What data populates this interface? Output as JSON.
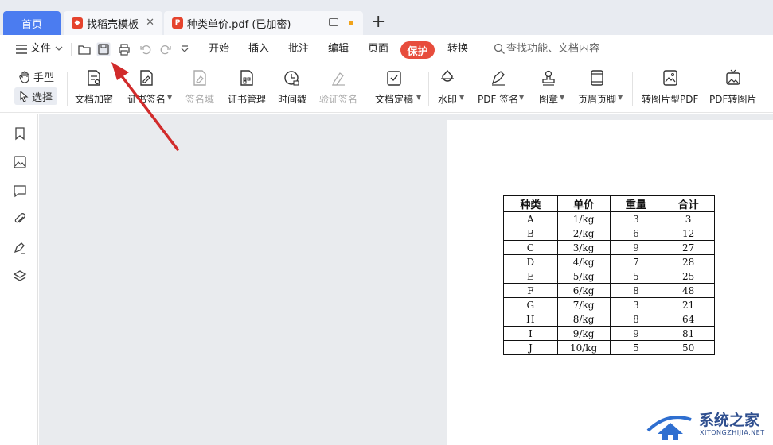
{
  "tabs": {
    "home": "首页",
    "tab1": "找稻壳模板",
    "tab2": "种类单价.pdf (已加密)"
  },
  "menu": {
    "file": "文件",
    "items": [
      "开始",
      "插入",
      "批注",
      "编辑",
      "页面",
      "保护",
      "转换"
    ],
    "search_placeholder": "查找功能、文档内容"
  },
  "ribbon": {
    "hand": "手型",
    "select": "选择",
    "buttons": [
      "文档加密",
      "证书签名",
      "签名域",
      "证书管理",
      "时间戳",
      "验证签名",
      "文档定稿",
      "水印",
      "PDF 签名",
      "图章",
      "页眉页脚",
      "转图片型PDF",
      "PDF转图片"
    ]
  },
  "table": {
    "headers": [
      "种类",
      "单价",
      "重量",
      "合计"
    ],
    "rows": [
      [
        "A",
        "1/kg",
        "3",
        "3"
      ],
      [
        "B",
        "2/kg",
        "6",
        "12"
      ],
      [
        "C",
        "3/kg",
        "9",
        "27"
      ],
      [
        "D",
        "4/kg",
        "7",
        "28"
      ],
      [
        "E",
        "5/kg",
        "5",
        "25"
      ],
      [
        "F",
        "6/kg",
        "8",
        "48"
      ],
      [
        "G",
        "7/kg",
        "3",
        "21"
      ],
      [
        "H",
        "8/kg",
        "8",
        "64"
      ],
      [
        "I",
        "9/kg",
        "9",
        "81"
      ],
      [
        "J",
        "10/kg",
        "5",
        "50"
      ]
    ]
  },
  "watermark": {
    "title": "系统之家",
    "url": "XITONGZHIJIA.NET"
  },
  "colors": {
    "accent": "#4b7cf0",
    "protect": "#e74c3c",
    "arrow": "#d12b2b"
  }
}
